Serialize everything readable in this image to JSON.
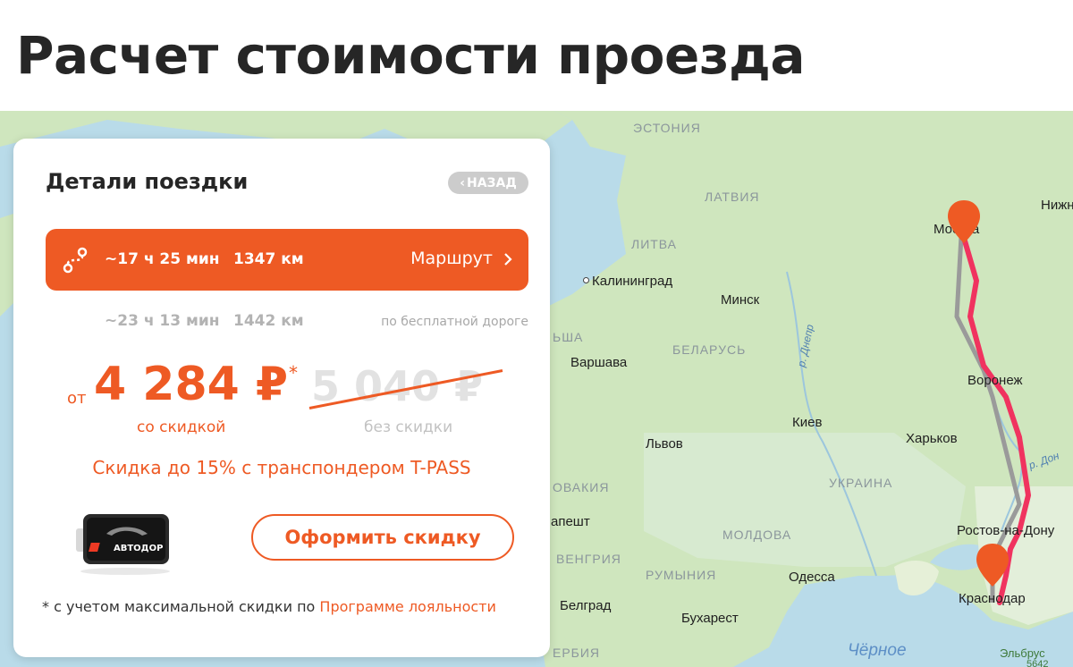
{
  "page": {
    "title": "Расчет стоимости проезда"
  },
  "card": {
    "title": "Детали поездки",
    "back_label": "НАЗАД",
    "routes": [
      {
        "time": "~17 ч 25 мин",
        "distance": "1347 км",
        "link_label": "Маршрут",
        "selected": true
      },
      {
        "time": "~23 ч 13 мин",
        "distance": "1442 км",
        "note": "по бесплатной дороге",
        "selected": false
      }
    ],
    "price": {
      "prefix": "от",
      "value": "4 284 ₽",
      "asterisk": "*",
      "old_value": "5 040 ₽",
      "label_discount": "со скидкой",
      "label_no_discount": "без скидки"
    },
    "promo_text": "Скидка до 15% с транспондером T-PASS",
    "transponder_brand": "АВТОДОР",
    "cta_label": "Оформить скидку",
    "footnote_text": "* с учетом максимальной скидки по ",
    "footnote_link": "Программе лояльности"
  },
  "map": {
    "countries": [
      "ЭСТОНИЯ",
      "ЛАТВИЯ",
      "ЛИТВА",
      "БЕЛАРУСЬ",
      "УКРАИНА",
      "МОЛДОВА",
      "РУМЫНИЯ",
      "ВЕНГРИЯ",
      "ОВАКИЯ",
      "ЬША",
      "ЕРБИЯ"
    ],
    "cities": [
      "Москва",
      "Воронеж",
      "Харьков",
      "Ростов-на-Дону",
      "Краснодар",
      "Калининград",
      "Минск",
      "Варшава",
      "Киев",
      "Львов",
      "Одесса",
      "Бухарест",
      "Белград",
      "апешт",
      "Нижн"
    ],
    "rivers": [
      "р. Днепр",
      "р. Дон"
    ],
    "sea": "Чёрное",
    "peak": "Эльбрус",
    "peak_height": "5642",
    "colors": {
      "water": "#b9dbe9",
      "land": "#cfe6be",
      "route_main": "#f0335f",
      "route_alt": "#9a9a9a",
      "pin": "#ee5a24",
      "accent": "#ee5a24"
    }
  }
}
